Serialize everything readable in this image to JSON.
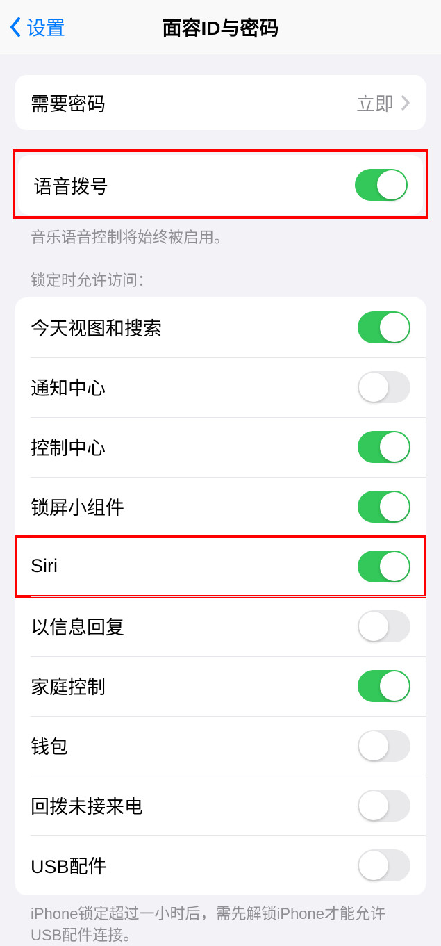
{
  "header": {
    "back_label": "设置",
    "title": "面容ID与密码"
  },
  "passcode": {
    "label": "需要密码",
    "value": "立即"
  },
  "voice_dial": {
    "label": "语音拨号",
    "enabled": true,
    "note": "音乐语音控制将始终被启用。"
  },
  "lock_access": {
    "section_title": "锁定时允许访问：",
    "items": [
      {
        "label": "今天视图和搜索",
        "enabled": true
      },
      {
        "label": "通知中心",
        "enabled": false
      },
      {
        "label": "控制中心",
        "enabled": true
      },
      {
        "label": "锁屏小组件",
        "enabled": true
      },
      {
        "label": "Siri",
        "enabled": true,
        "highlighted": true
      },
      {
        "label": "以信息回复",
        "enabled": false
      },
      {
        "label": "家庭控制",
        "enabled": true
      },
      {
        "label": "钱包",
        "enabled": false
      },
      {
        "label": "回拨未接来电",
        "enabled": false
      },
      {
        "label": "USB配件",
        "enabled": false
      }
    ],
    "footer_note": "iPhone锁定超过一小时后，需先解锁iPhone才能允许USB配件连接。"
  }
}
